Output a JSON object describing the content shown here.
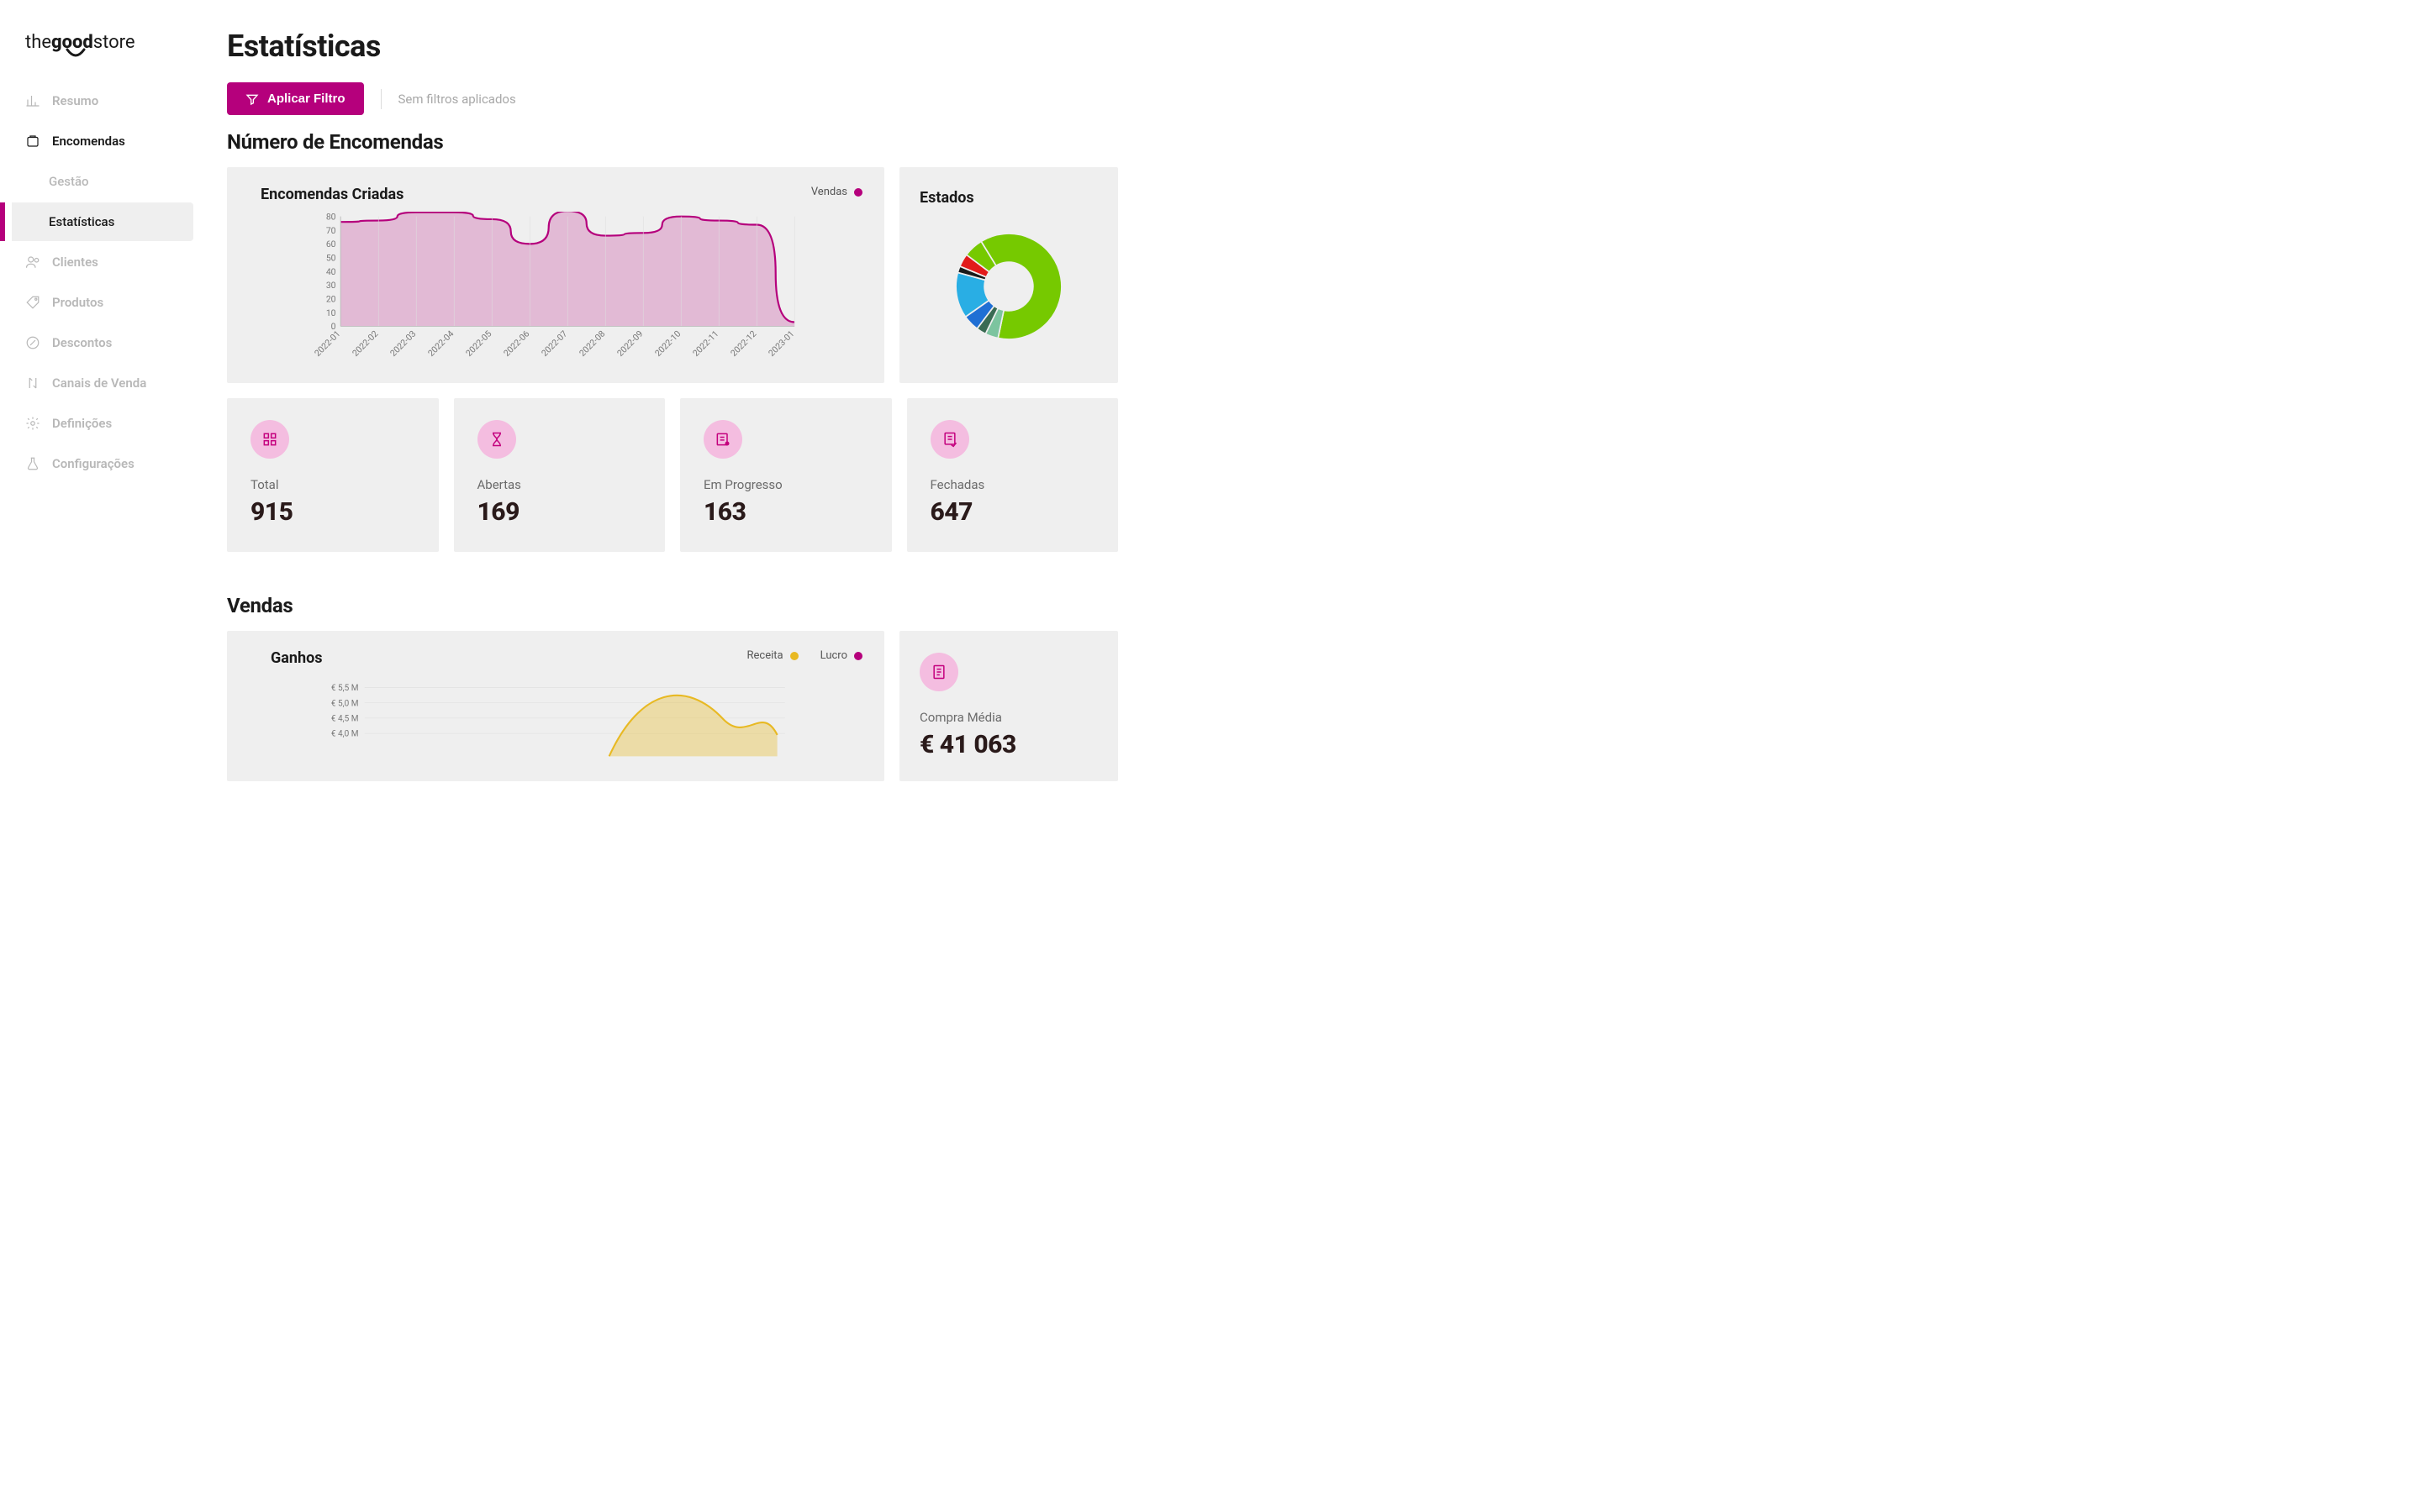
{
  "brand": {
    "pre": "the",
    "bold": "good",
    "post": "store"
  },
  "sidebar": {
    "items": [
      {
        "label": "Resumo"
      },
      {
        "label": "Encomendas",
        "sub": [
          {
            "label": "Gestão"
          },
          {
            "label": "Estatísticas"
          }
        ]
      },
      {
        "label": "Clientes"
      },
      {
        "label": "Produtos"
      },
      {
        "label": "Descontos"
      },
      {
        "label": "Canais de Venda"
      },
      {
        "label": "Definições"
      },
      {
        "label": "Configurações"
      }
    ]
  },
  "page": {
    "title": "Estatísticas"
  },
  "filter": {
    "button": "Aplicar Filtro",
    "status": "Sem filtros aplicados"
  },
  "sections": {
    "orders_title": "Número de Encomendas",
    "sales_title": "Vendas"
  },
  "orders_chart_card": {
    "title": "Encomendas Criadas",
    "legend_sales": "Vendas"
  },
  "states_card": {
    "title": "Estados"
  },
  "stats": {
    "total": {
      "label": "Total",
      "value": "915"
    },
    "open": {
      "label": "Abertas",
      "value": "169"
    },
    "progress": {
      "label": "Em Progresso",
      "value": "163"
    },
    "closed": {
      "label": "Fechadas",
      "value": "647"
    }
  },
  "earnings_card": {
    "title": "Ganhos",
    "legend_revenue": "Receita",
    "legend_profit": "Lucro"
  },
  "avg_purchase": {
    "label": "Compra Média",
    "value": "€ 41 063"
  },
  "chart_data": [
    {
      "type": "area",
      "title": "Encomendas Criadas",
      "xlabel": "",
      "ylabel": "",
      "ylim": [
        0,
        80
      ],
      "yticks": [
        0,
        10,
        20,
        30,
        40,
        50,
        60,
        70,
        80
      ],
      "categories": [
        "2022-01",
        "2022-02",
        "2022-03",
        "2022-04",
        "2022-05",
        "2022-06",
        "2022-07",
        "2022-08",
        "2022-09",
        "2022-10",
        "2022-11",
        "2022-12",
        "2023-01"
      ],
      "series": [
        {
          "name": "Vendas",
          "color": "#b5007c",
          "values": [
            76,
            77,
            83,
            83,
            78,
            60,
            84,
            66,
            68,
            80,
            77,
            74,
            3
          ]
        }
      ]
    },
    {
      "type": "pie",
      "title": "Estados",
      "series": [
        {
          "name": "s1",
          "color": "#76c900",
          "value": 62
        },
        {
          "name": "s2",
          "color": "#7cc49f",
          "value": 4
        },
        {
          "name": "s3",
          "color": "#3a6b53",
          "value": 3
        },
        {
          "name": "s4",
          "color": "#1f6fd4",
          "value": 5
        },
        {
          "name": "s5",
          "color": "#29aee4",
          "value": 14
        },
        {
          "name": "s6",
          "color": "#1a1a1a",
          "value": 2
        },
        {
          "name": "s7",
          "color": "#e21a1a",
          "value": 4
        },
        {
          "name": "s8",
          "color": "#76c900",
          "value": 6
        }
      ]
    },
    {
      "type": "area",
      "title": "Ganhos",
      "xlabel": "",
      "ylabel": "",
      "yticks_labels": [
        "€ 5,5 M",
        "€ 5,0 M",
        "€ 4,5 M",
        "€ 4,0 M"
      ],
      "ylim": [
        3500000,
        5500000
      ],
      "series": [
        {
          "name": "Receita",
          "color": "#e8b923"
        },
        {
          "name": "Lucro",
          "color": "#b5007c"
        }
      ],
      "note": "partial — chart cut off at bottom of viewport"
    }
  ],
  "colors": {
    "accent": "#b5007c",
    "accent_light": "#f4bde0",
    "panel": "#efefef",
    "muted": "#b8b8b8",
    "yellow": "#e8b923"
  }
}
